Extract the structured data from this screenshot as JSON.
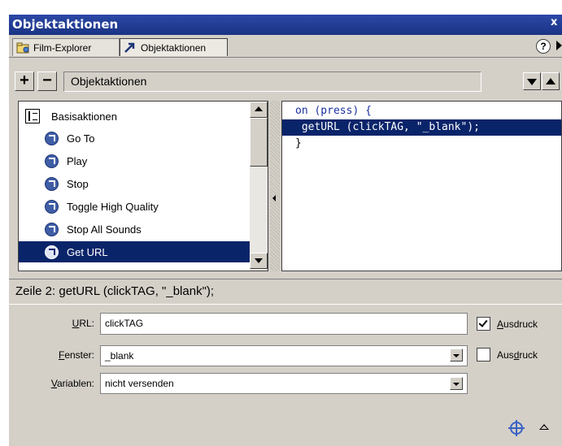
{
  "window": {
    "title": "Objektaktionen",
    "close_glyph": "x"
  },
  "tabs": [
    {
      "label": "Film-Explorer",
      "icon": "film-explorer-icon"
    },
    {
      "label": "Objektaktionen",
      "icon": "action-arrow-icon"
    }
  ],
  "help_glyph": "?",
  "toolbar": {
    "add_label": "+",
    "remove_label": "−",
    "panel_title": "Objektaktionen"
  },
  "tree": {
    "category": "Basisaktionen",
    "items": [
      {
        "label": "Go To"
      },
      {
        "label": "Play"
      },
      {
        "label": "Stop"
      },
      {
        "label": "Toggle High Quality"
      },
      {
        "label": "Stop All Sounds"
      },
      {
        "label": "Get URL",
        "selected": true
      }
    ]
  },
  "code": {
    "lines": [
      "on (press) {",
      " getURL (clickTAG, \"_blank\");",
      "}"
    ],
    "selected_line": 2
  },
  "status": {
    "text": "Zeile 2: getURL (clickTAG, \"_blank\");"
  },
  "params": {
    "url": {
      "label_pre": "",
      "label_ul": "U",
      "label_post": "RL:",
      "value": "clickTAG",
      "expr_checked": true,
      "expr_label_pre": "",
      "expr_label_ul": "A",
      "expr_label_post": "usdruck"
    },
    "window": {
      "label_pre": "",
      "label_ul": "F",
      "label_post": "enster:",
      "value": "_blank",
      "expr_checked": false,
      "expr_label_pre": "Aus",
      "expr_label_ul": "d",
      "expr_label_post": "ruck"
    },
    "variables": {
      "label_pre": "",
      "label_ul": "V",
      "label_post": "ariablen:",
      "value": "nicht versenden"
    }
  },
  "colors": {
    "title_bar": "#1a3384",
    "selection": "#0a246a",
    "panel": "#d4d0c8"
  }
}
